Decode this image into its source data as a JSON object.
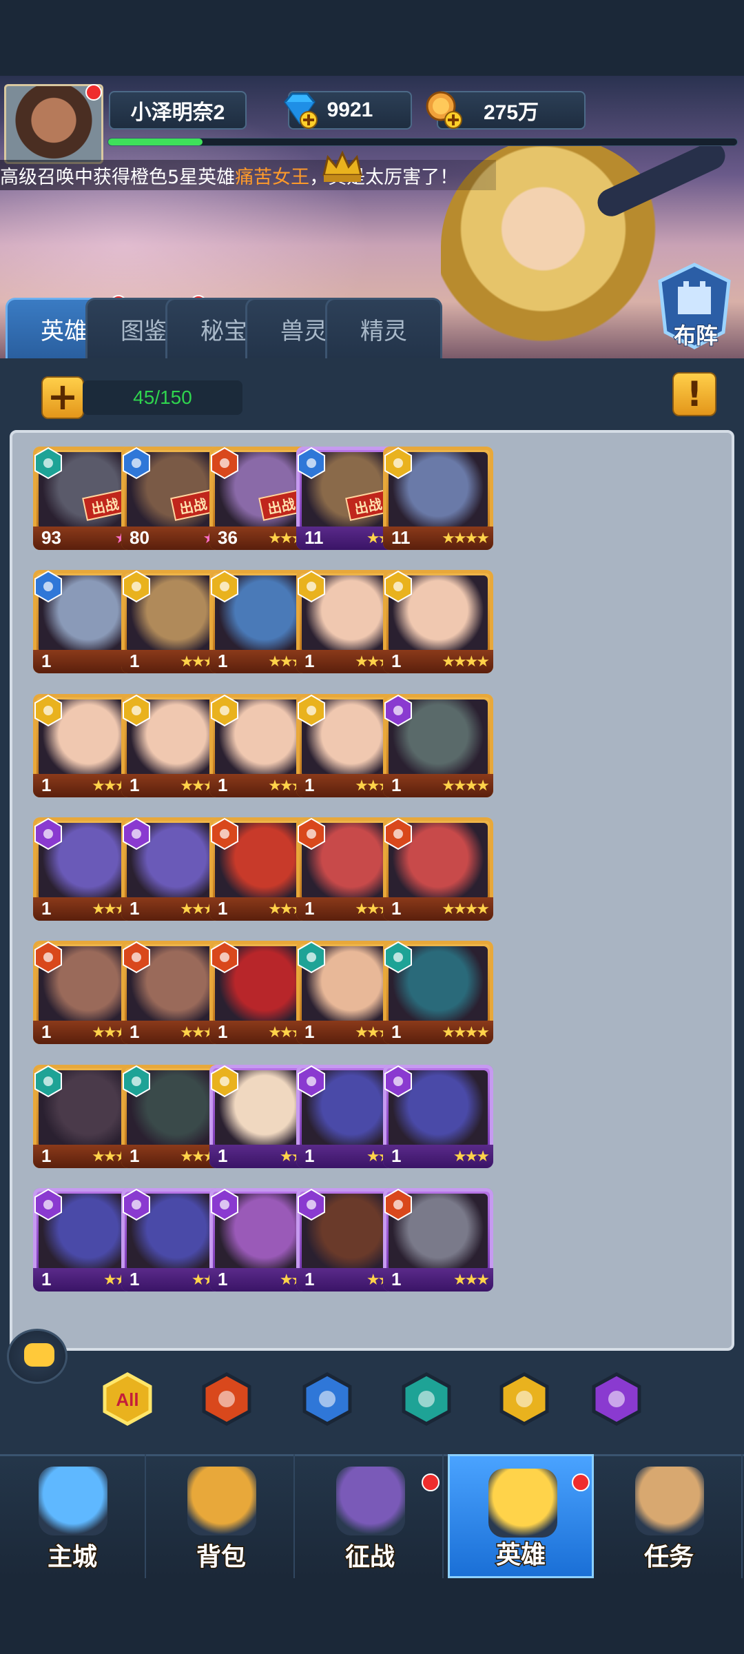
{
  "player": {
    "name": "小泽明奈2",
    "gems": "9921",
    "gold": "275万",
    "xp_fraction": 0.15
  },
  "marquee": {
    "prefix": "高级召唤中获得橙色5星英雄",
    "hero": "痛苦女王",
    "suffix": "，真是太厉害了！"
  },
  "tabs": [
    {
      "label": "英雄",
      "active": true,
      "dot": true
    },
    {
      "label": "图鉴",
      "active": false,
      "dot": true
    },
    {
      "label": "秘宝",
      "active": false,
      "dot": false
    },
    {
      "label": "兽灵",
      "active": false,
      "dot": false
    },
    {
      "label": "精灵",
      "active": false,
      "dot": false
    }
  ],
  "formation_label": "布阵",
  "hero_count": "45/150",
  "deploy_label": "出战",
  "colors": {
    "fire": "#d9481c",
    "water": "#2f77d8",
    "death": "#1ea396",
    "light": "#e9b21e",
    "dark": "#8a3ad0"
  },
  "heroes": [
    {
      "level": "93",
      "stars": 2,
      "pink": true,
      "faction": "death",
      "rarity": "legend",
      "deployed": true,
      "dot": true,
      "color": "#5a5a6a"
    },
    {
      "level": "80",
      "stars": 2,
      "pink": true,
      "faction": "water",
      "rarity": "legend",
      "deployed": true,
      "dot": true,
      "color": "#7a5a46"
    },
    {
      "level": "36",
      "stars": 4,
      "pink": false,
      "faction": "fire",
      "rarity": "legend",
      "deployed": true,
      "dot": true,
      "color": "#8a6aa8"
    },
    {
      "level": "11",
      "stars": 3,
      "pink": false,
      "faction": "water",
      "rarity": "epic",
      "deployed": true,
      "dot": true,
      "color": "#8a6a4a"
    },
    {
      "level": "11",
      "stars": 4,
      "pink": false,
      "faction": "light",
      "rarity": "legend",
      "deployed": false,
      "dot": false,
      "color": "#6a7aa8"
    },
    {
      "level": "1",
      "stars": 1,
      "pink": true,
      "faction": "water",
      "rarity": "legend",
      "deployed": false,
      "dot": false,
      "color": "#8a9ab8"
    },
    {
      "level": "1",
      "stars": 4,
      "pink": false,
      "faction": "light",
      "rarity": "legend",
      "deployed": false,
      "dot": false,
      "color": "#b08a5a"
    },
    {
      "level": "1",
      "stars": 4,
      "pink": false,
      "faction": "light",
      "rarity": "legend",
      "deployed": false,
      "dot": false,
      "color": "#4a7ab8"
    },
    {
      "level": "1",
      "stars": 4,
      "pink": false,
      "faction": "light",
      "rarity": "legend",
      "deployed": false,
      "dot": false,
      "color": "#f0c8b0"
    },
    {
      "level": "1",
      "stars": 4,
      "pink": false,
      "faction": "light",
      "rarity": "legend",
      "deployed": false,
      "dot": false,
      "color": "#f0c8b0"
    },
    {
      "level": "1",
      "stars": 4,
      "pink": false,
      "faction": "light",
      "rarity": "legend",
      "deployed": false,
      "dot": false,
      "color": "#f0c8b0"
    },
    {
      "level": "1",
      "stars": 4,
      "pink": false,
      "faction": "light",
      "rarity": "legend",
      "deployed": false,
      "dot": false,
      "color": "#f0c8b0"
    },
    {
      "level": "1",
      "stars": 4,
      "pink": false,
      "faction": "light",
      "rarity": "legend",
      "deployed": false,
      "dot": false,
      "color": "#f0c8b0"
    },
    {
      "level": "1",
      "stars": 4,
      "pink": false,
      "faction": "light",
      "rarity": "legend",
      "deployed": false,
      "dot": false,
      "color": "#f0c8b0"
    },
    {
      "level": "1",
      "stars": 4,
      "pink": false,
      "faction": "dark",
      "rarity": "legend",
      "deployed": false,
      "dot": false,
      "color": "#5a6a6a"
    },
    {
      "level": "1",
      "stars": 4,
      "pink": false,
      "faction": "dark",
      "rarity": "legend",
      "deployed": false,
      "dot": false,
      "color": "#6a5ab8"
    },
    {
      "level": "1",
      "stars": 4,
      "pink": false,
      "faction": "dark",
      "rarity": "legend",
      "deployed": false,
      "dot": false,
      "color": "#6a5ab8"
    },
    {
      "level": "1",
      "stars": 4,
      "pink": false,
      "faction": "fire",
      "rarity": "legend",
      "deployed": false,
      "dot": false,
      "color": "#c83a2a"
    },
    {
      "level": "1",
      "stars": 4,
      "pink": false,
      "faction": "fire",
      "rarity": "legend",
      "deployed": false,
      "dot": false,
      "color": "#c84a4a"
    },
    {
      "level": "1",
      "stars": 4,
      "pink": false,
      "faction": "fire",
      "rarity": "legend",
      "deployed": false,
      "dot": false,
      "color": "#c84a4a"
    },
    {
      "level": "1",
      "stars": 4,
      "pink": false,
      "faction": "fire",
      "rarity": "legend",
      "deployed": false,
      "dot": false,
      "color": "#9a6a5a"
    },
    {
      "level": "1",
      "stars": 4,
      "pink": false,
      "faction": "fire",
      "rarity": "legend",
      "deployed": false,
      "dot": false,
      "color": "#9a6a5a"
    },
    {
      "level": "1",
      "stars": 4,
      "pink": false,
      "faction": "fire",
      "rarity": "legend",
      "deployed": false,
      "dot": false,
      "color": "#b8262a"
    },
    {
      "level": "1",
      "stars": 4,
      "pink": false,
      "faction": "death",
      "rarity": "legend",
      "deployed": false,
      "dot": false,
      "color": "#e8b898"
    },
    {
      "level": "1",
      "stars": 4,
      "pink": false,
      "faction": "death",
      "rarity": "legend",
      "deployed": false,
      "dot": false,
      "color": "#2a6a7a"
    },
    {
      "level": "1",
      "stars": 4,
      "pink": false,
      "faction": "death",
      "rarity": "legend",
      "deployed": false,
      "dot": false,
      "color": "#4a3a4a"
    },
    {
      "level": "1",
      "stars": 4,
      "pink": false,
      "faction": "death",
      "rarity": "legend",
      "deployed": false,
      "dot": false,
      "color": "#3a4a4a"
    },
    {
      "level": "1",
      "stars": 3,
      "pink": false,
      "faction": "light",
      "rarity": "epic",
      "deployed": false,
      "dot": false,
      "color": "#f0d8c0"
    },
    {
      "level": "1",
      "stars": 3,
      "pink": false,
      "faction": "dark",
      "rarity": "epic",
      "deployed": false,
      "dot": false,
      "color": "#4a4aa8"
    },
    {
      "level": "1",
      "stars": 3,
      "pink": false,
      "faction": "dark",
      "rarity": "epic",
      "deployed": false,
      "dot": false,
      "color": "#4a4aa8"
    },
    {
      "level": "1",
      "stars": 3,
      "pink": false,
      "faction": "dark",
      "rarity": "epic",
      "deployed": false,
      "dot": false,
      "color": "#4a4aa8"
    },
    {
      "level": "1",
      "stars": 3,
      "pink": false,
      "faction": "dark",
      "rarity": "epic",
      "deployed": false,
      "dot": false,
      "color": "#4a4aa8"
    },
    {
      "level": "1",
      "stars": 3,
      "pink": false,
      "faction": "dark",
      "rarity": "epic",
      "deployed": false,
      "dot": false,
      "color": "#9a5ab8"
    },
    {
      "level": "1",
      "stars": 3,
      "pink": false,
      "faction": "dark",
      "rarity": "epic",
      "deployed": false,
      "dot": false,
      "color": "#6a3a2a"
    },
    {
      "level": "1",
      "stars": 3,
      "pink": false,
      "faction": "fire",
      "rarity": "epic",
      "deployed": false,
      "dot": false,
      "color": "#7a7a8a"
    }
  ],
  "filters": [
    {
      "name": "filter-all",
      "label": "All",
      "color": "#e9b21e"
    },
    {
      "name": "filter-fire",
      "label": "",
      "color": "#d9481c"
    },
    {
      "name": "filter-water",
      "label": "",
      "color": "#2f77d8"
    },
    {
      "name": "filter-death",
      "label": "",
      "color": "#1ea396"
    },
    {
      "name": "filter-light",
      "label": "",
      "color": "#e9b21e"
    },
    {
      "name": "filter-dark",
      "label": "",
      "color": "#8a3ad0"
    }
  ],
  "nav": [
    {
      "label": "主城",
      "active": false,
      "dot": false
    },
    {
      "label": "背包",
      "active": false,
      "dot": false
    },
    {
      "label": "征战",
      "active": false,
      "dot": true
    },
    {
      "label": "英雄",
      "active": true,
      "dot": true
    },
    {
      "label": "任务",
      "active": false,
      "dot": false
    }
  ]
}
